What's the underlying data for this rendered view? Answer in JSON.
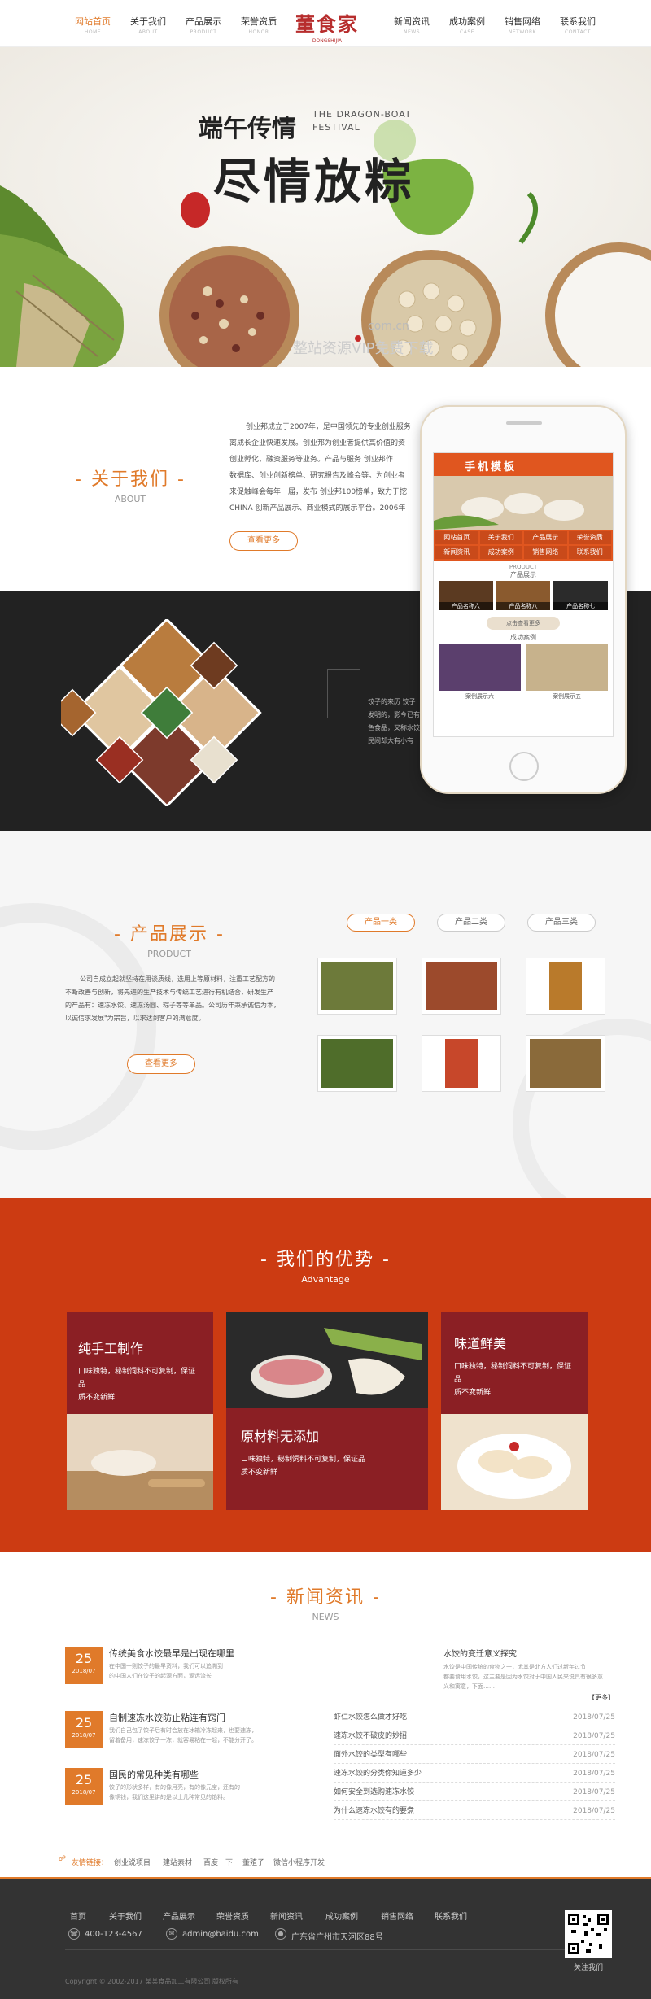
{
  "header": {
    "logo_text": "董食家",
    "logo_sub": "DONGSHIJIA",
    "nav_left": [
      {
        "cn": "网站首页",
        "en": "HOME"
      },
      {
        "cn": "关于我们",
        "en": "ABOUT"
      },
      {
        "cn": "产品展示",
        "en": "PRODUCT"
      },
      {
        "cn": "荣誉资质",
        "en": "HONOR"
      }
    ],
    "nav_right": [
      {
        "cn": "新闻资讯",
        "en": "NEWS"
      },
      {
        "cn": "成功案例",
        "en": "CASE"
      },
      {
        "cn": "销售网络",
        "en": "NETWORK"
      },
      {
        "cn": "联系我们",
        "en": "CONTACT"
      }
    ],
    "accent": "#e07a2a"
  },
  "banner": {
    "headline_small": "端午传情",
    "headline_big": "尽情放粽",
    "en_line1": "THE DRAGON-BOAT",
    "en_line2": "FESTIVAL"
  },
  "watermark": {
    "w1": "com.cn",
    "w2": "整站资源VIP免费下载"
  },
  "about": {
    "title": "关于我们",
    "sub": "ABOUT",
    "text_lines": [
      "创业邦成立于2007年，是中国领先的专业创业服务",
      "离成长企业快速发展。创业邦为创业者提供高价值的资",
      "创业孵化、融资服务等业务。产品与服务 创业邦作",
      "数据库、创业创新榜单、研究报告及峰会等。为创业者",
      "来促触峰会每年一届，发布 创业邦100榜单，致力于挖",
      "CHINA 创新产品展示、商业模式的展示平台。2006年"
    ],
    "more": "查看更多"
  },
  "phone": {
    "title": "手机模板",
    "menu": [
      "网站首页",
      "关于我们",
      "产品展示",
      "荣誉资质",
      "新闻资讯",
      "成功案例",
      "销售网络",
      "联系我们"
    ],
    "product_label": "产品展示",
    "product_en": "PRODUCT",
    "products": [
      "产品名称六",
      "产品名称八",
      "产品名称七"
    ],
    "more": "点击查看更多",
    "case_label": "成功案例",
    "cases": [
      "案例展示六",
      "案例展示五"
    ]
  },
  "dark": {
    "text_lines": [
      "饺子的来历 饺子",
      "发明的，影今已有",
      "色食品，又称水饺",
      "民间却大有小有"
    ]
  },
  "products": {
    "title": "产品展示",
    "sub": "PRODUCT",
    "text_lines": [
      "公司自成立起就坚持在用谈质线，选用上等原材料，注重工艺配方的",
      "不断改善与创新，将先进的生产技术与传统工艺进行有机结合，研发生产",
      "的产品有：速冻水饺、速冻汤圆、粽子等等单品。公司历年秉承诚信为本，",
      "以诚信求发展\"为宗旨，以求达到客户的满意度。"
    ],
    "more": "查看更多",
    "tabs": [
      "产品一类",
      "产品二类",
      "产品三类"
    ]
  },
  "advantage": {
    "title": "我们的优势",
    "sub": "Advantage",
    "cards": [
      {
        "title": "纯手工制作",
        "line1": "口味独特，秘制饲料不可复制，保证品",
        "line2": "质不变新鲜"
      },
      {
        "title": "原材料无添加",
        "line1": "口味独特，秘制饲料不可复制，保证品",
        "line2": "质不变新鲜"
      },
      {
        "title": "味道鲜美",
        "line1": "口味独特，秘制饲料不可复制，保证品",
        "line2": "质不变新鲜"
      }
    ]
  },
  "news": {
    "title": "新闻资讯",
    "sub": "NEWS",
    "items": [
      {
        "day": "25",
        "ym": "2018/07",
        "title": "传统美食水饺最早是出现在哪里",
        "desc1": "在中国一则饺子的最早资料，我们可以追溯到",
        "desc2": "的中国人们在饺子的起源方面，源远流长"
      },
      {
        "day": "25",
        "ym": "2018/07",
        "title": "自制速冻水饺防止粘连有窍门",
        "desc1": "我们自己包了饺子后有时会放在冰箱冷冻起来，也要速冻，",
        "desc2": "留着备用，速冻饺子一冻，就容易粘在一起，不能分开了。"
      },
      {
        "day": "25",
        "ym": "2018/07",
        "title": "国民的常见种类有哪些",
        "desc1": "饺子的形状多样，有的像月亮，有的像元宝，还有的",
        "desc2": "像铜钱，我们这里讲的是以上几种常见的馅料。"
      }
    ],
    "feature_title": "水饺的变迁意义探究",
    "feature_desc1": "水饺是中国传统的食物之一，尤其是北方人们过新年过节",
    "feature_desc2": "都要食用水饺，这主要是因为水饺对于中国人民来说具有很多意",
    "feature_desc3": "义和寓意，下面……",
    "feature_more": "【更多】",
    "list": [
      {
        "title": "虾仁水饺怎么做才好吃",
        "date": "2018/07/25"
      },
      {
        "title": "速冻水饺不破皮的妙招",
        "date": "2018/07/25"
      },
      {
        "title": "面外水饺的类型有哪些",
        "date": "2018/07/25"
      },
      {
        "title": "速冻水饺的分类你知道多少",
        "date": "2018/07/25"
      },
      {
        "title": "如何安全到选购速冻水饺",
        "date": "2018/07/25"
      },
      {
        "title": "为什么速冻水饺有的要煮",
        "date": "2018/07/25"
      }
    ]
  },
  "links": {
    "label": "友情链接：",
    "items": [
      "创业说项目",
      "建站素材",
      "百度一下",
      "董殖子",
      "微信小程序开发"
    ]
  },
  "footer": {
    "nav": [
      "首页",
      "关于我们",
      "产品展示",
      "荣誉资质",
      "新闻资讯",
      "成功案例",
      "销售网络",
      "联系我们"
    ],
    "phone": "400-123-4567",
    "email": "admin@baidu.com",
    "address": "广东省广州市天河区88号",
    "copyright": "Copyright © 2002-2017 某某食品加工有限公司 版权所有",
    "qr_label": "关注我们"
  }
}
